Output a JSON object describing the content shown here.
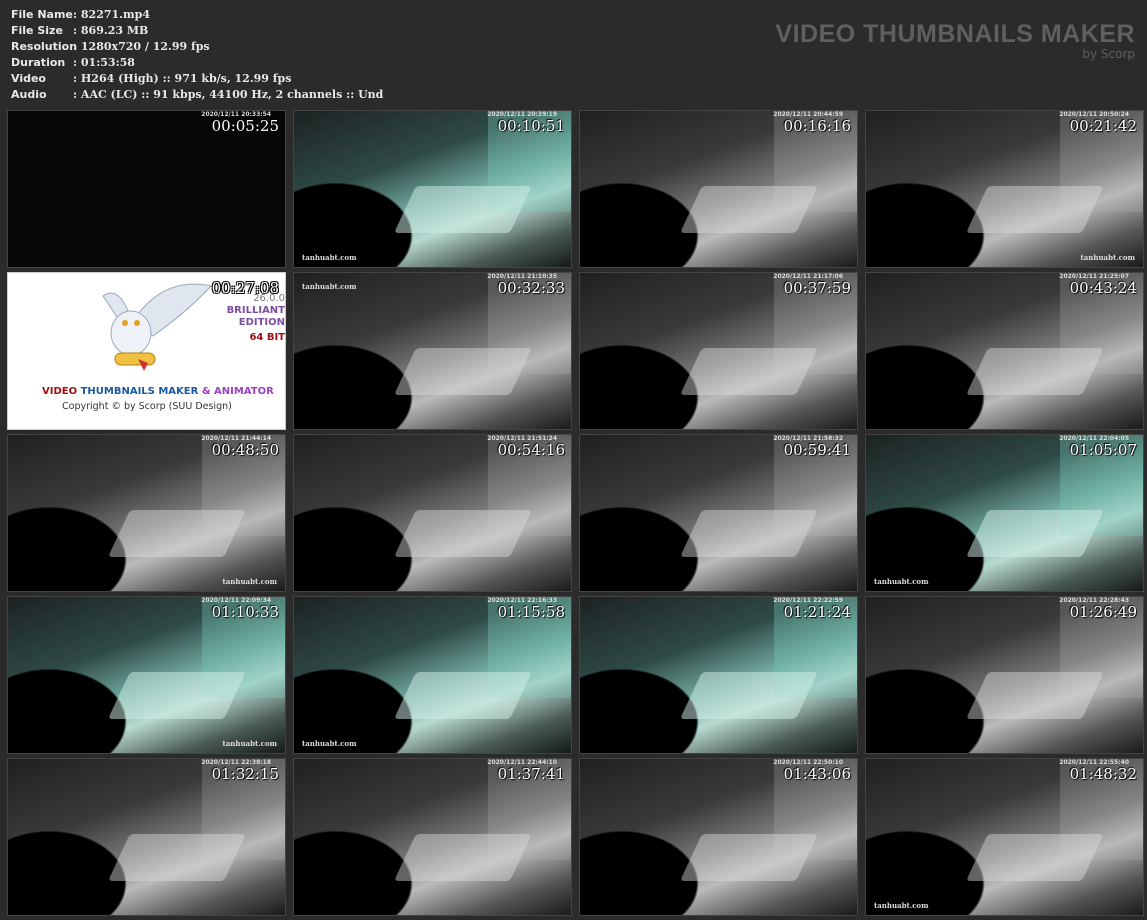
{
  "info": [
    {
      "label": "File Name",
      "value": "82271.mp4"
    },
    {
      "label": "File Size",
      "value": "869.23 MB"
    },
    {
      "label": "Resolution",
      "value": "1280x720 / 12.99 fps"
    },
    {
      "label": "Duration",
      "value": "01:53:58"
    },
    {
      "label": "Video",
      "value": "H264 (High) :: 971 kb/s, 12.99 fps"
    },
    {
      "label": "Audio",
      "value": "AAC (LC) :: 91 kbps, 44100 Hz, 2 channels :: Und"
    }
  ],
  "separator": ":",
  "brand": {
    "title": "VIDEO THUMBNAILS MAKER",
    "subtitle": "by Scorp"
  },
  "logo": {
    "timestamp": "00:27:08",
    "version": "26.0.0",
    "edition1": "BRILLIANT",
    "edition2": "EDITION",
    "bits": "64 BIT",
    "name_a": "VIDEO ",
    "name_b": "THUMBNAILS MAKER ",
    "name_c": "& ANIMATOR",
    "copyright": "Copyright © by Scorp (SUU Design)"
  },
  "thumbnails": [
    {
      "time": "00:05:25",
      "stamp": "2020/12/11 20:33:54",
      "tone": "black",
      "watermark": ""
    },
    {
      "time": "00:10:51",
      "stamp": "2020/12/11 20:39:19",
      "tone": "teal",
      "watermark": "tanhuabt.com",
      "wm_side": "l"
    },
    {
      "time": "00:16:16",
      "stamp": "2020/12/11 20:44:59",
      "tone": "gray",
      "watermark": ""
    },
    {
      "time": "00:21:42",
      "stamp": "2020/12/11 20:50:24",
      "tone": "gray",
      "watermark": "tanhuabt.com",
      "wm_side": "r"
    },
    {
      "logo": true
    },
    {
      "time": "00:32:33",
      "stamp": "2020/12/11 21:10:35",
      "tone": "gray",
      "watermark": "tanhuabt.com",
      "wm_side": "top"
    },
    {
      "time": "00:37:59",
      "stamp": "2020/12/11 21:17:06",
      "tone": "gray",
      "watermark": ""
    },
    {
      "time": "00:43:24",
      "stamp": "2020/12/11 21:25:07",
      "tone": "gray",
      "watermark": ""
    },
    {
      "time": "00:48:50",
      "stamp": "2020/12/11 21:44:14",
      "tone": "gray",
      "watermark": "tanhuabt.com",
      "wm_side": "r"
    },
    {
      "time": "00:54:16",
      "stamp": "2020/12/11 21:51:24",
      "tone": "gray",
      "watermark": ""
    },
    {
      "time": "00:59:41",
      "stamp": "2020/12/11 21:58:32",
      "tone": "gray",
      "watermark": ""
    },
    {
      "time": "01:05:07",
      "stamp": "2020/12/11 22:04:05",
      "tone": "teal",
      "watermark": "tanhuabt.com",
      "wm_side": "l"
    },
    {
      "time": "01:10:33",
      "stamp": "2020/12/11 22:09:34",
      "tone": "teal",
      "watermark": "tanhuabt.com",
      "wm_side": "r"
    },
    {
      "time": "01:15:58",
      "stamp": "2020/12/11 22:16:33",
      "tone": "teal",
      "watermark": "tanhuabt.com",
      "wm_side": "l"
    },
    {
      "time": "01:21:24",
      "stamp": "2020/12/11 22:22:59",
      "tone": "teal",
      "watermark": ""
    },
    {
      "time": "01:26:49",
      "stamp": "2020/12/11 22:28:43",
      "tone": "gray",
      "watermark": ""
    },
    {
      "time": "01:32:15",
      "stamp": "2020/12/11 22:38:18",
      "tone": "gray",
      "watermark": ""
    },
    {
      "time": "01:37:41",
      "stamp": "2020/12/11 22:44:10",
      "tone": "gray",
      "watermark": ""
    },
    {
      "time": "01:43:06",
      "stamp": "2020/12/11 22:50:10",
      "tone": "gray",
      "watermark": ""
    },
    {
      "time": "01:48:32",
      "stamp": "2020/12/11 22:55:40",
      "tone": "gray",
      "watermark": "tanhuabt.com",
      "wm_side": "l"
    }
  ]
}
